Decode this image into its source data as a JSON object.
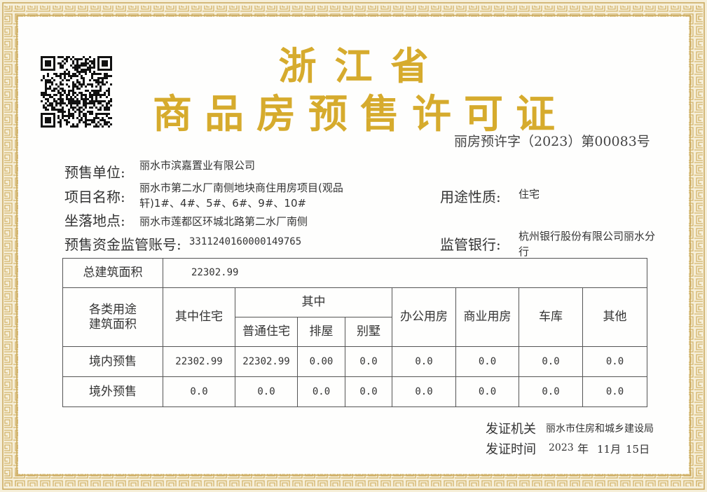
{
  "certificate": {
    "title_line1": "浙江省",
    "title_line2": "商品房预售许可证",
    "number": "丽房预许字（2023）第00083号"
  },
  "fields": {
    "seller_label": "预售单位:",
    "seller_value": "丽水市滨嘉置业有限公司",
    "project_label": "项目名称:",
    "project_value_line1": "丽水市第二水厂南侧地块商住用房项目(观品",
    "project_value_line2": "轩)1#、4#、5#、6#、9#、10#",
    "location_label": "坐落地点:",
    "location_value": "丽水市莲都区环城北路第二水厂南侧",
    "account_label": "预售资金监管账号:",
    "account_value": "3311240160000149765",
    "usage_label": "用途性质:",
    "usage_value": "住宅",
    "bank_label": "监管银行:",
    "bank_value_line1": "杭州银行股份有限公司丽水分",
    "bank_value_line2": "行"
  },
  "table": {
    "total_label": "总建筑面积",
    "total_value": "22302.99",
    "category_label_line1": "各类用途",
    "category_label_line2": "建筑面积",
    "headers": {
      "residential": "其中住宅",
      "of_which": "其中",
      "ordinary": "普通住宅",
      "townhouse": "排屋",
      "villa": "别墅",
      "office": "办公用房",
      "commercial": "商业用房",
      "garage": "车库",
      "other": "其他"
    },
    "rows": [
      {
        "label": "境内预售",
        "residential": "22302.99",
        "ordinary": "22302.99",
        "townhouse": "0.00",
        "villa": "0.0",
        "office": "0.0",
        "commercial": "0.0",
        "garage": "0.0",
        "other": "0.0"
      },
      {
        "label": "境外预售",
        "residential": "0.0",
        "ordinary": "0.0",
        "townhouse": "0.0",
        "villa": "0.0",
        "office": "0.0",
        "commercial": "0.0",
        "garage": "0.0",
        "other": "0.0"
      }
    ]
  },
  "issuer": {
    "authority_label": "发证机关",
    "authority_value": "丽水市住房和城乡建设局",
    "date_label": "发证时间",
    "year": "2023",
    "year_unit": "年",
    "month": "11月",
    "day": "15日"
  },
  "colors": {
    "title_gold": "#d6ab2d",
    "border_gold": "#d9bd7a",
    "background": "#fbf9f2"
  }
}
